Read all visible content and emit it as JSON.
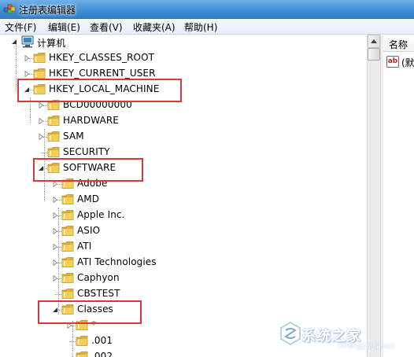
{
  "window": {
    "title": "注册表编辑器"
  },
  "menu": [
    {
      "label": "文件(F)"
    },
    {
      "label": "编辑(E)"
    },
    {
      "label": "查看(V)"
    },
    {
      "label": "收藏夹(A)"
    },
    {
      "label": "帮助(H)"
    }
  ],
  "tree": {
    "root": "计算机",
    "items": [
      {
        "label": "HKEY_CLASSES_ROOT",
        "expander": "collapsed"
      },
      {
        "label": "HKEY_CURRENT_USER",
        "expander": "collapsed"
      },
      {
        "label": "HKEY_LOCAL_MACHINE",
        "expander": "expanded"
      },
      {
        "label": "BCD00000000",
        "expander": "collapsed"
      },
      {
        "label": "HARDWARE",
        "expander": "collapsed"
      },
      {
        "label": "SAM",
        "expander": "collapsed"
      },
      {
        "label": "SECURITY",
        "expander": "none"
      },
      {
        "label": "SOFTWARE",
        "expander": "expanded"
      },
      {
        "label": "Adobe",
        "expander": "collapsed"
      },
      {
        "label": "AMD",
        "expander": "collapsed"
      },
      {
        "label": "Apple Inc.",
        "expander": "collapsed"
      },
      {
        "label": "ASIO",
        "expander": "collapsed"
      },
      {
        "label": "ATI",
        "expander": "collapsed"
      },
      {
        "label": "ATI Technologies",
        "expander": "collapsed"
      },
      {
        "label": "Caphyon",
        "expander": "collapsed"
      },
      {
        "label": "CBSTEST",
        "expander": "none"
      },
      {
        "label": "Classes",
        "expander": "expanded"
      },
      {
        "label": "*",
        "expander": "collapsed"
      },
      {
        "label": ".001",
        "expander": "none"
      },
      {
        "label": ".002",
        "expander": "none"
      }
    ]
  },
  "rightpane": {
    "column_header": "名称",
    "first_value": "(默"
  },
  "watermark": {
    "text": "系统之家",
    "url": "XiTongZhiJia.net"
  },
  "colors": {
    "highlight": "#d83a3a",
    "folder": "#f2cf5b",
    "titlebar": "#3f8fd6"
  }
}
